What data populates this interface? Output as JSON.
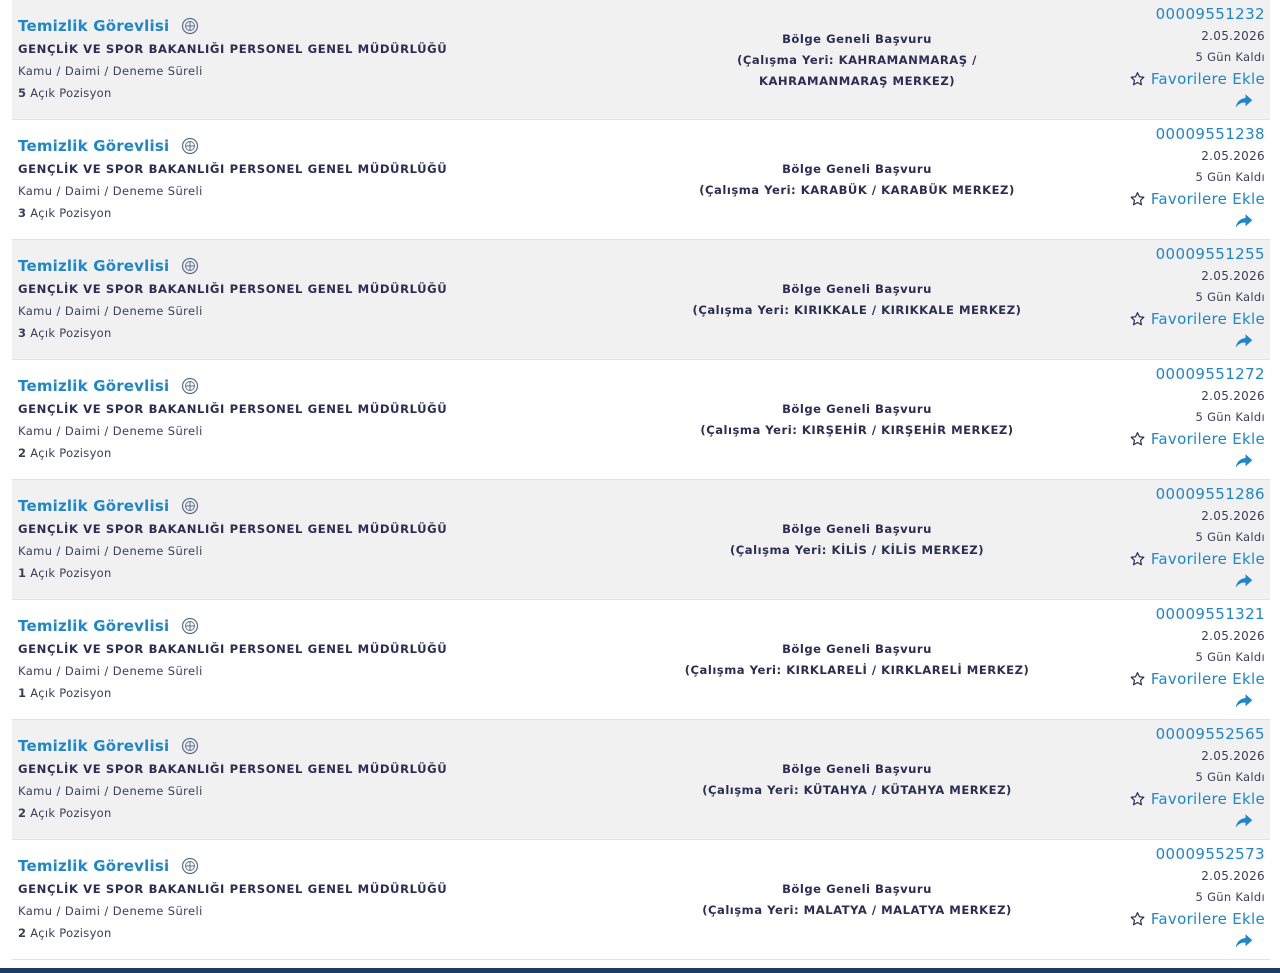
{
  "listings": [
    {
      "title": "Temizlik Görevlisi",
      "org": "GENÇLİK VE SPOR BAKANLIĞI PERSONEL GENEL MÜDÜRLÜĞÜ",
      "meta": "Kamu / Daimi / Deneme Süreli",
      "positions": "5",
      "positions_label": "Açık Pozisyon",
      "application": "Bölge Geneli Başvuru",
      "location": "(Çalışma Yeri: KAHRAMANMARAŞ / KAHRAMANMARAŞ MERKEZ)",
      "ilan_no": "00009551232",
      "date": "2.05.2026",
      "remaining": "5 Gün Kaldı",
      "fav_label": "Favorilere Ekle"
    },
    {
      "title": "Temizlik Görevlisi",
      "org": "GENÇLİK VE SPOR BAKANLIĞI PERSONEL GENEL MÜDÜRLÜĞÜ",
      "meta": "Kamu / Daimi / Deneme Süreli",
      "positions": "3",
      "positions_label": "Açık Pozisyon",
      "application": "Bölge Geneli Başvuru",
      "location": "(Çalışma Yeri: KARABÜK / KARABÜK MERKEZ)",
      "ilan_no": "00009551238",
      "date": "2.05.2026",
      "remaining": "5 Gün Kaldı",
      "fav_label": "Favorilere Ekle"
    },
    {
      "title": "Temizlik Görevlisi",
      "org": "GENÇLİK VE SPOR BAKANLIĞI PERSONEL GENEL MÜDÜRLÜĞÜ",
      "meta": "Kamu / Daimi / Deneme Süreli",
      "positions": "3",
      "positions_label": "Açık Pozisyon",
      "application": "Bölge Geneli Başvuru",
      "location": "(Çalışma Yeri: KIRIKKALE / KIRIKKALE MERKEZ)",
      "ilan_no": "00009551255",
      "date": "2.05.2026",
      "remaining": "5 Gün Kaldı",
      "fav_label": "Favorilere Ekle"
    },
    {
      "title": "Temizlik Görevlisi",
      "org": "GENÇLİK VE SPOR BAKANLIĞI PERSONEL GENEL MÜDÜRLÜĞÜ",
      "meta": "Kamu / Daimi / Deneme Süreli",
      "positions": "2",
      "positions_label": "Açık Pozisyon",
      "application": "Bölge Geneli Başvuru",
      "location": "(Çalışma Yeri: KIRŞEHİR / KIRŞEHİR MERKEZ)",
      "ilan_no": "00009551272",
      "date": "2.05.2026",
      "remaining": "5 Gün Kaldı",
      "fav_label": "Favorilere Ekle"
    },
    {
      "title": "Temizlik Görevlisi",
      "org": "GENÇLİK VE SPOR BAKANLIĞI PERSONEL GENEL MÜDÜRLÜĞÜ",
      "meta": "Kamu / Daimi / Deneme Süreli",
      "positions": "1",
      "positions_label": "Açık Pozisyon",
      "application": "Bölge Geneli Başvuru",
      "location": "(Çalışma Yeri: KİLİS / KİLİS MERKEZ)",
      "ilan_no": "00009551286",
      "date": "2.05.2026",
      "remaining": "5 Gün Kaldı",
      "fav_label": "Favorilere Ekle"
    },
    {
      "title": "Temizlik Görevlisi",
      "org": "GENÇLİK VE SPOR BAKANLIĞI PERSONEL GENEL MÜDÜRLÜĞÜ",
      "meta": "Kamu / Daimi / Deneme Süreli",
      "positions": "1",
      "positions_label": "Açık Pozisyon",
      "application": "Bölge Geneli Başvuru",
      "location": "(Çalışma Yeri: KIRKLARELİ / KIRKLARELİ MERKEZ)",
      "ilan_no": "00009551321",
      "date": "2.05.2026",
      "remaining": "5 Gün Kaldı",
      "fav_label": "Favorilere Ekle"
    },
    {
      "title": "Temizlik Görevlisi",
      "org": "GENÇLİK VE SPOR BAKANLIĞI PERSONEL GENEL MÜDÜRLÜĞÜ",
      "meta": "Kamu / Daimi / Deneme Süreli",
      "positions": "2",
      "positions_label": "Açık Pozisyon",
      "application": "Bölge Geneli Başvuru",
      "location": "(Çalışma Yeri: KÜTAHYA / KÜTAHYA MERKEZ)",
      "ilan_no": "00009552565",
      "date": "2.05.2026",
      "remaining": "5 Gün Kaldı",
      "fav_label": "Favorilere Ekle"
    },
    {
      "title": "Temizlik Görevlisi",
      "org": "GENÇLİK VE SPOR BAKANLIĞI PERSONEL GENEL MÜDÜRLÜĞÜ",
      "meta": "Kamu / Daimi / Deneme Süreli",
      "positions": "2",
      "positions_label": "Açık Pozisyon",
      "application": "Bölge Geneli Başvuru",
      "location": "(Çalışma Yeri: MALATYA / MALATYA MERKEZ)",
      "ilan_no": "00009552573",
      "date": "2.05.2026",
      "remaining": "5 Gün Kaldı",
      "fav_label": "Favorilere Ekle"
    }
  ],
  "icons": {
    "emblem": "ministry-emblem-icon",
    "star": "star-outline-icon",
    "share": "share-arrow-icon"
  },
  "colors": {
    "link": "#1f86c8",
    "text": "#2b2d52",
    "row_alt": "#f1f1f2",
    "bottom_bar": "#1c3c63"
  }
}
